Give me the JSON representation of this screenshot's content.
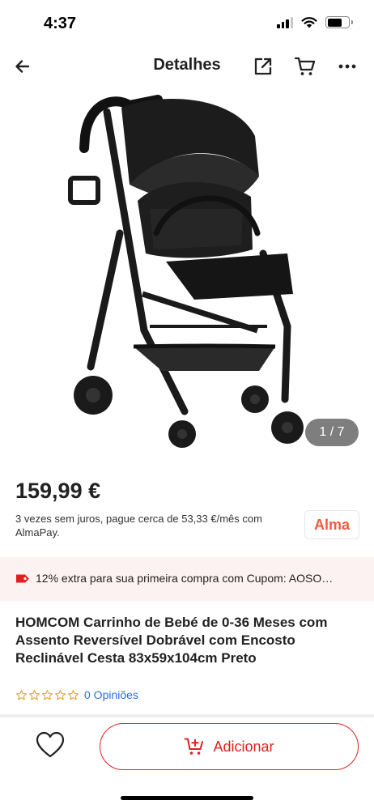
{
  "status": {
    "time": "4:37"
  },
  "header": {
    "title": "Detalhes",
    "icons": [
      "back-arrow-icon",
      "share-icon",
      "cart-icon",
      "more-icon"
    ]
  },
  "gallery": {
    "counter": "1 / 7",
    "image": "black-stroller-photo"
  },
  "price": {
    "amount": "159,99 €",
    "installments": "3 vezes sem juros, pague cerca de 53,33 €/mês com AlmaPay.",
    "provider_badge": "Alma"
  },
  "coupon": {
    "text": "12% extra para sua primeira compra com Cupom: AOSO…",
    "icon": "tag-icon"
  },
  "product": {
    "title": "HOMCOM Carrinho de Bebé de 0-36 Meses com Assento Reversível Dobrável com Encosto Reclinável Cesta 83x59x104cm Preto",
    "rating": 0,
    "reviews": "0 Opiniões"
  },
  "bottom": {
    "add_label": "Adicionar",
    "icons": [
      "heart-icon",
      "add-to-cart-icon"
    ]
  },
  "colors": {
    "accent": "#e02020",
    "alma": "#f25a3c",
    "link": "#2d6fd2",
    "coupon_bg": "#fdf2f2",
    "star_outline": "#e0a530"
  }
}
